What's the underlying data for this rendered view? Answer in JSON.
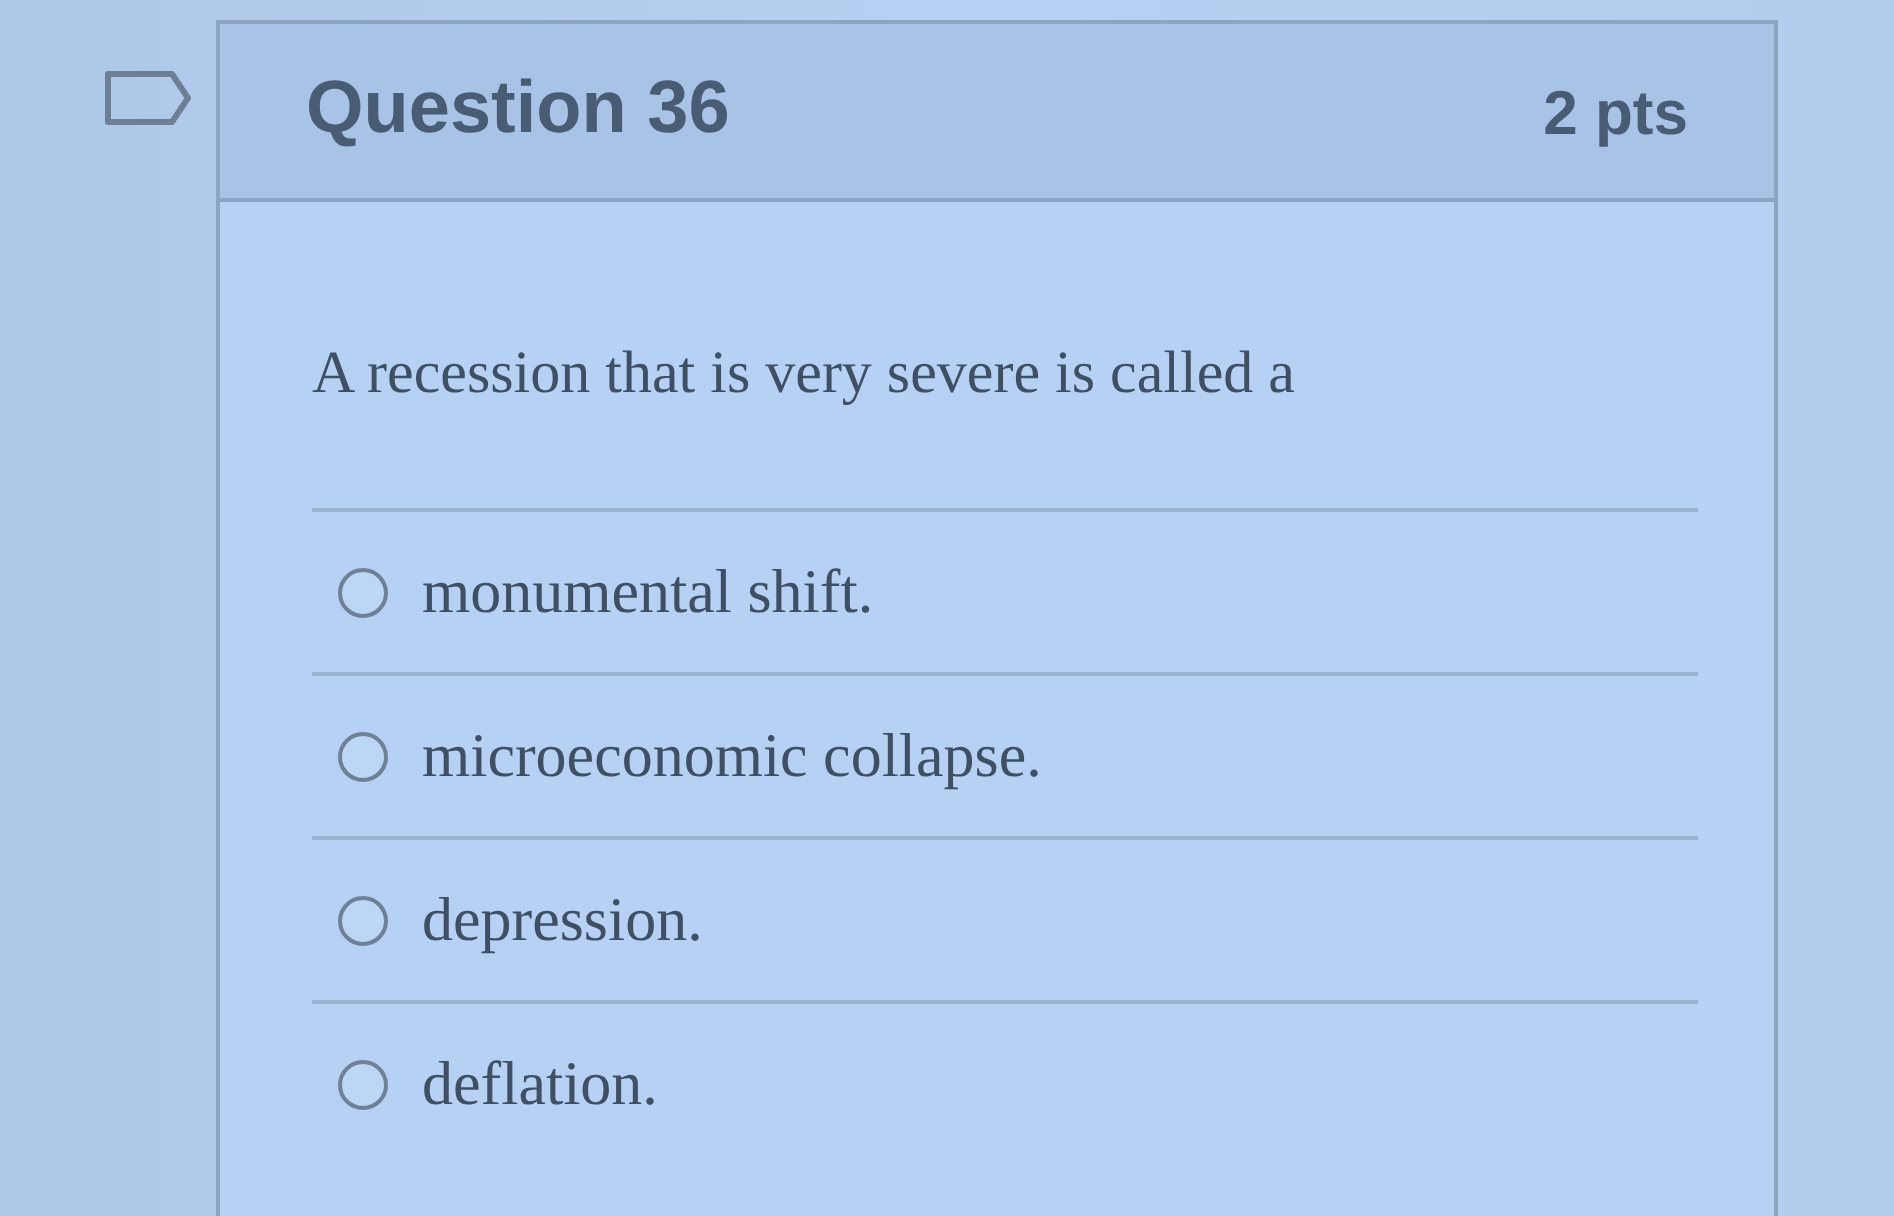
{
  "question": {
    "title": "Question 36",
    "points": "2 pts",
    "flagged": false,
    "text": "A recession that is very severe is called a",
    "answers": [
      {
        "label": "monumental shift.",
        "selected": false
      },
      {
        "label": "microeconomic collapse.",
        "selected": false
      },
      {
        "label": "depression.",
        "selected": false
      },
      {
        "label": "deflation.",
        "selected": false
      }
    ]
  }
}
